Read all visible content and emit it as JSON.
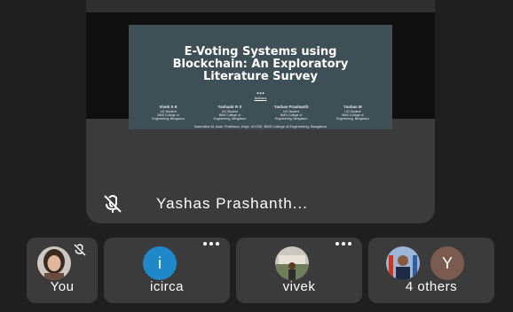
{
  "presentation": {
    "title_lines": [
      "E-Voting Systems using",
      "Blockchain: An Exploratory",
      "Literature Survey"
    ],
    "dots": "...",
    "authors_label": "Authors",
    "authors": [
      {
        "name": "Vivek S K",
        "line1": "UG Student",
        "line2": "BMS College of",
        "line3": "Engineering, Bengaluru"
      },
      {
        "name": "Yashank R S",
        "line1": "UG Student",
        "line2": "BMS College of",
        "line3": "Engineering, Bengaluru"
      },
      {
        "name": "Yashas Prashanth",
        "line1": "UG Student",
        "line2": "BMS College of",
        "line3": "Engineering, Bengaluru"
      },
      {
        "name": "Yashas M",
        "line1": "UG Student",
        "line2": "BMS College of",
        "line3": "Engineering, Bengaluru"
      }
    ],
    "guide": "Namratha M, Asst. Professor, Dept. of CSE, BMS College of Engineering, Bengaluru"
  },
  "presenter": {
    "name": "Yashas Prashanth...",
    "mic_icon": "mic-off-icon"
  },
  "participants": [
    {
      "label": "You",
      "avatar": "photo",
      "mic_icon": "mic-off-icon"
    },
    {
      "label": "icirca",
      "avatar_letter": "i",
      "avatar_color": "#1e88c8"
    },
    {
      "label": "vivek",
      "avatar": "photo"
    },
    {
      "label": "4 others",
      "avatar_letter": "Y",
      "avatar_color": "#7b5a4f"
    }
  ],
  "colors": {
    "background": "#1f1f1f",
    "tile": "#3b3b3b",
    "slide": "#3e4f56"
  }
}
